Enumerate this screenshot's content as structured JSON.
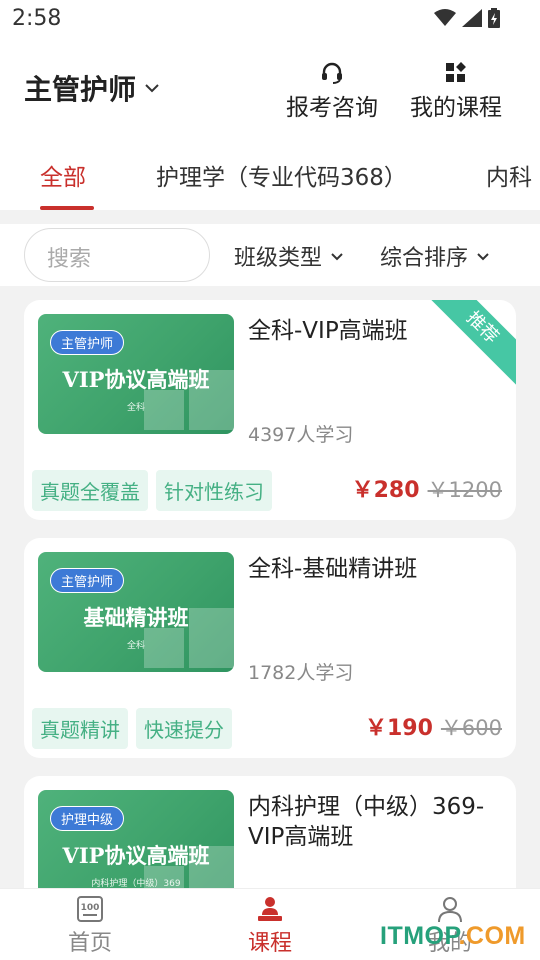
{
  "status_bar": {
    "time": "2:58"
  },
  "header": {
    "title": "主管护师",
    "consult_label": "报考咨询",
    "my_courses_label": "我的课程"
  },
  "tabs": [
    {
      "label": "全部",
      "active": true
    },
    {
      "label": "护理学（专业代码368）",
      "active": false
    },
    {
      "label": "内科",
      "active": false
    }
  ],
  "filters": {
    "search_placeholder": "搜索",
    "class_type_label": "班级类型",
    "sort_label": "综合排序"
  },
  "courses": [
    {
      "thumb_tag": "主管护师",
      "thumb_title": "VIP协议高端班",
      "thumb_subtitle": "全科",
      "title": "全科-VIP高端班",
      "learners": "4397人学习",
      "tags": [
        "真题全覆盖",
        "针对性练习"
      ],
      "price": "￥280",
      "original_price": "￥1200",
      "ribbon": "推荐"
    },
    {
      "thumb_tag": "主管护师",
      "thumb_title": "基础精讲班",
      "thumb_subtitle": "全科",
      "title": "全科-基础精讲班",
      "learners": "1782人学习",
      "tags": [
        "真题精讲",
        "快速提分"
      ],
      "price": "￥190",
      "original_price": "￥600"
    },
    {
      "thumb_tag": "护理中级",
      "thumb_title": "VIP协议高端班",
      "thumb_subtitle": "内科护理（中级）369",
      "title": "内科护理（中级）369-VIP高端班"
    }
  ],
  "bottom_nav": [
    {
      "label": "首页",
      "icon": "exam-100-icon",
      "active": false
    },
    {
      "label": "课程",
      "icon": "teacher-icon",
      "active": true
    },
    {
      "label": "我的",
      "icon": "user-icon",
      "active": false
    }
  ],
  "watermark": {
    "text_a": "ITMOP",
    "text_b": ".COM"
  },
  "colors": {
    "accent": "#c9302c",
    "tag_green": "#45b084",
    "ribbon": "#46c7a4",
    "thumb_green": "#3fa36c"
  }
}
